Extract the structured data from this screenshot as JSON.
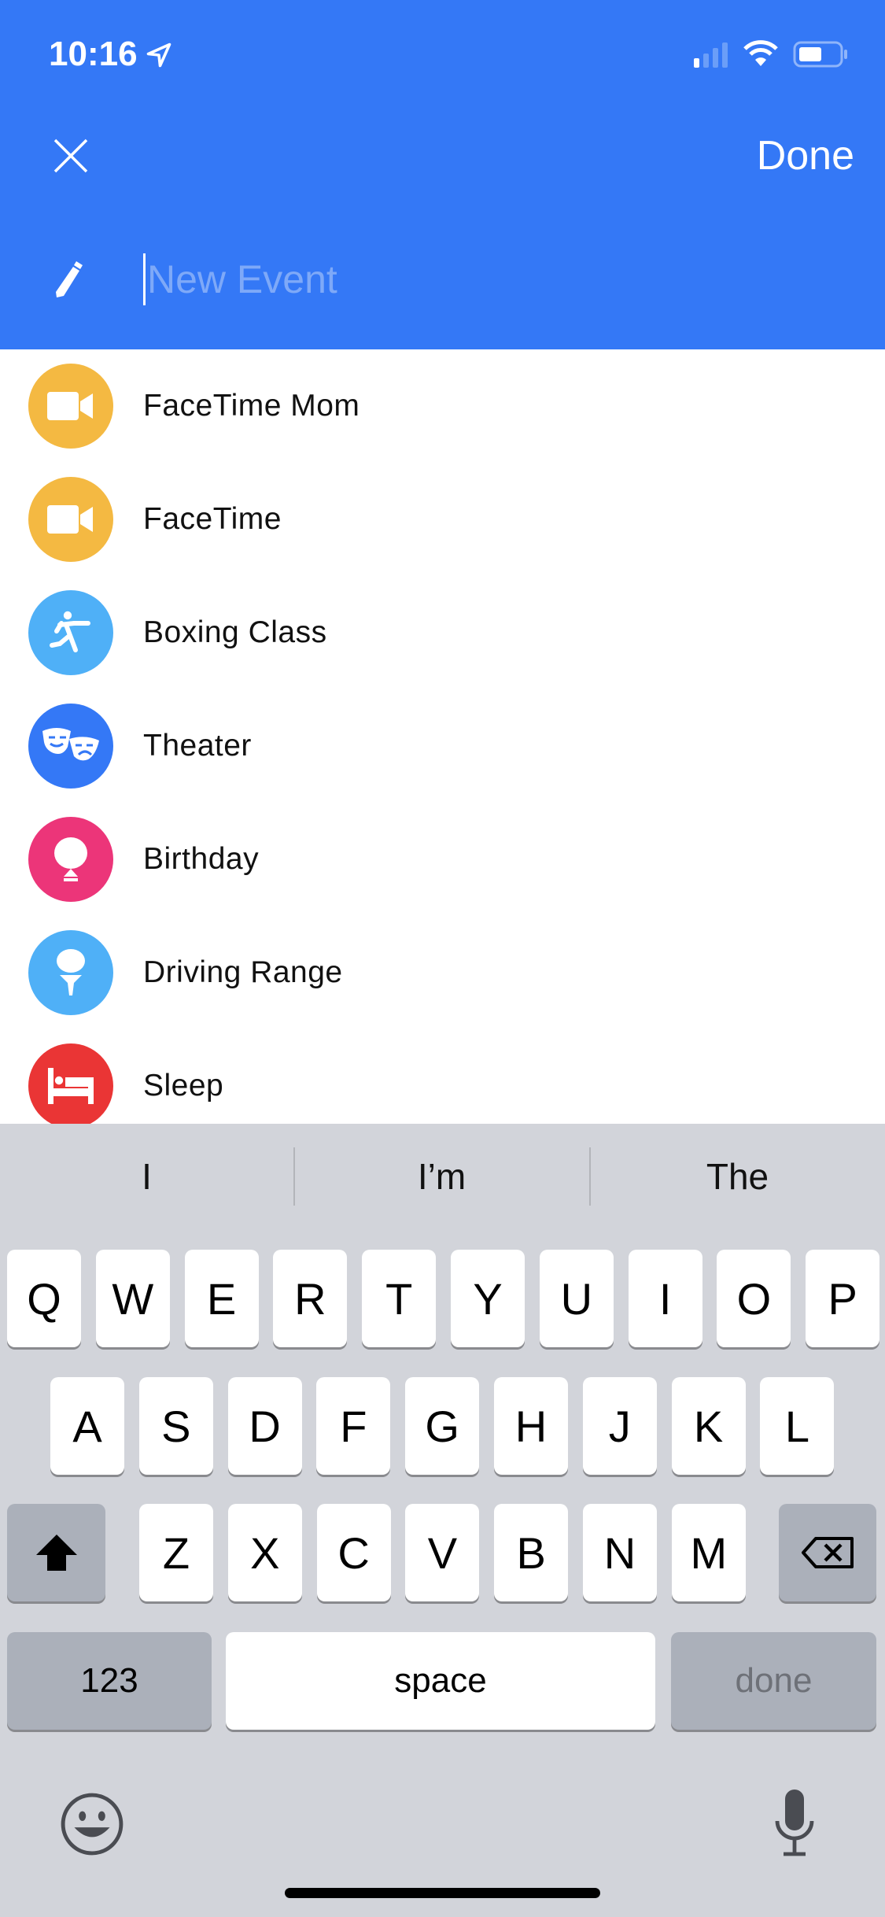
{
  "status_bar": {
    "time": "10:16",
    "icons": [
      "location-arrow-icon",
      "cellular-signal-icon",
      "wifi-icon",
      "battery-icon"
    ]
  },
  "header": {
    "close_icon": "close-icon",
    "done_label": "Done",
    "edit_icon": "pencil-icon",
    "title_placeholder": "New Event",
    "title_value": "",
    "color": "#3478f6"
  },
  "suggestions": [
    {
      "label": "FaceTime Mom",
      "icon": "video-camera-icon",
      "color": "#f4b942"
    },
    {
      "label": "FaceTime",
      "icon": "video-camera-icon",
      "color": "#f4b942"
    },
    {
      "label": "Boxing Class",
      "icon": "boxing-figure-icon",
      "color": "#4fb0f7"
    },
    {
      "label": "Theater",
      "icon": "theater-masks-icon",
      "color": "#3478f6"
    },
    {
      "label": "Birthday",
      "icon": "balloon-icon",
      "color": "#ec3579"
    },
    {
      "label": "Driving Range",
      "icon": "golf-tee-icon",
      "color": "#4fb0f7"
    },
    {
      "label": "Sleep",
      "icon": "bed-icon",
      "color": "#ea3535"
    }
  ],
  "keyboard": {
    "predictions": [
      "I",
      "I’m",
      "The"
    ],
    "row1": [
      "Q",
      "W",
      "E",
      "R",
      "T",
      "Y",
      "U",
      "I",
      "O",
      "P"
    ],
    "row2": [
      "A",
      "S",
      "D",
      "F",
      "G",
      "H",
      "J",
      "K",
      "L"
    ],
    "row3": [
      "Z",
      "X",
      "C",
      "V",
      "B",
      "N",
      "M"
    ],
    "numbers_label": "123",
    "space_label": "space",
    "done_label": "done"
  }
}
